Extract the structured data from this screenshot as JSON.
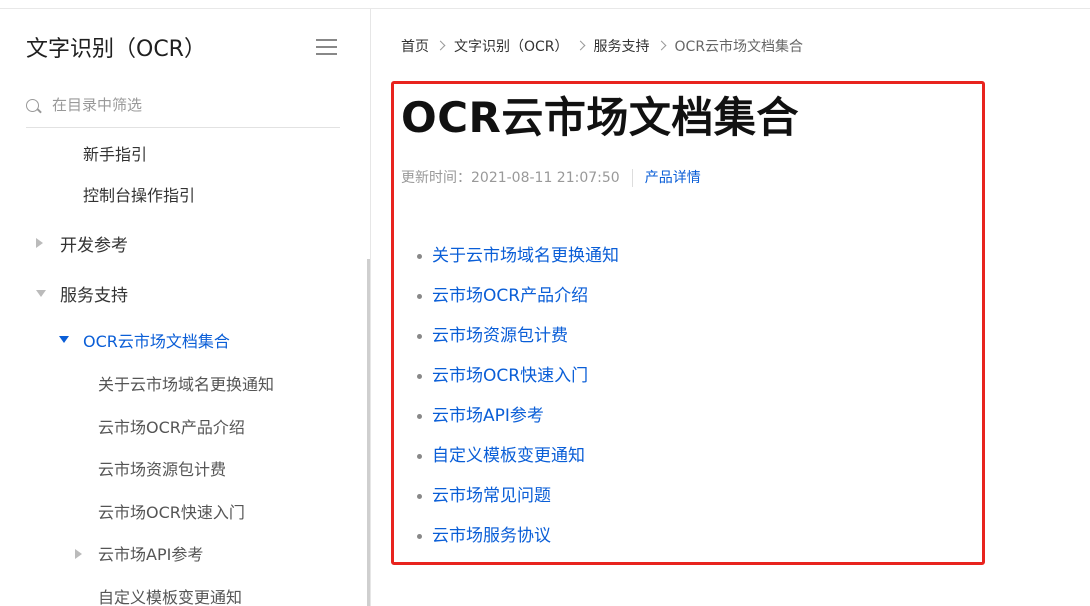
{
  "sidebar": {
    "title": "文字识别（OCR）",
    "filter_placeholder": "在目录中筛选",
    "partial_item": "新手指引",
    "items": [
      {
        "label": "控制台操作指引"
      },
      {
        "label": "开发参考"
      },
      {
        "label": "服务支持"
      },
      {
        "label": "OCR云市场文档集合"
      },
      {
        "label": "关于云市场域名更换通知"
      },
      {
        "label": "云市场OCR产品介绍"
      },
      {
        "label": "云市场资源包计费"
      },
      {
        "label": "云市场OCR快速入门"
      },
      {
        "label": "云市场API参考"
      },
      {
        "label": "自定义模板变更通知"
      }
    ]
  },
  "breadcrumb": {
    "items": [
      "首页",
      "文字识别（OCR）",
      "服务支持"
    ],
    "current": "OCR云市场文档集合"
  },
  "main": {
    "title": "OCR云市场文档集合",
    "updated_label": "更新时间：2021-08-11 21:07:50",
    "product_link": "产品详情",
    "links": [
      "关于云市场域名更换通知",
      "云市场OCR产品介绍",
      "云市场资源包计费",
      "云市场OCR快速入门",
      "云市场API参考",
      "自定义模板变更通知",
      "云市场常见问题",
      "云市场服务协议"
    ]
  },
  "colors": {
    "link": "#0a5ed7",
    "highlight_border": "#e8231e"
  }
}
